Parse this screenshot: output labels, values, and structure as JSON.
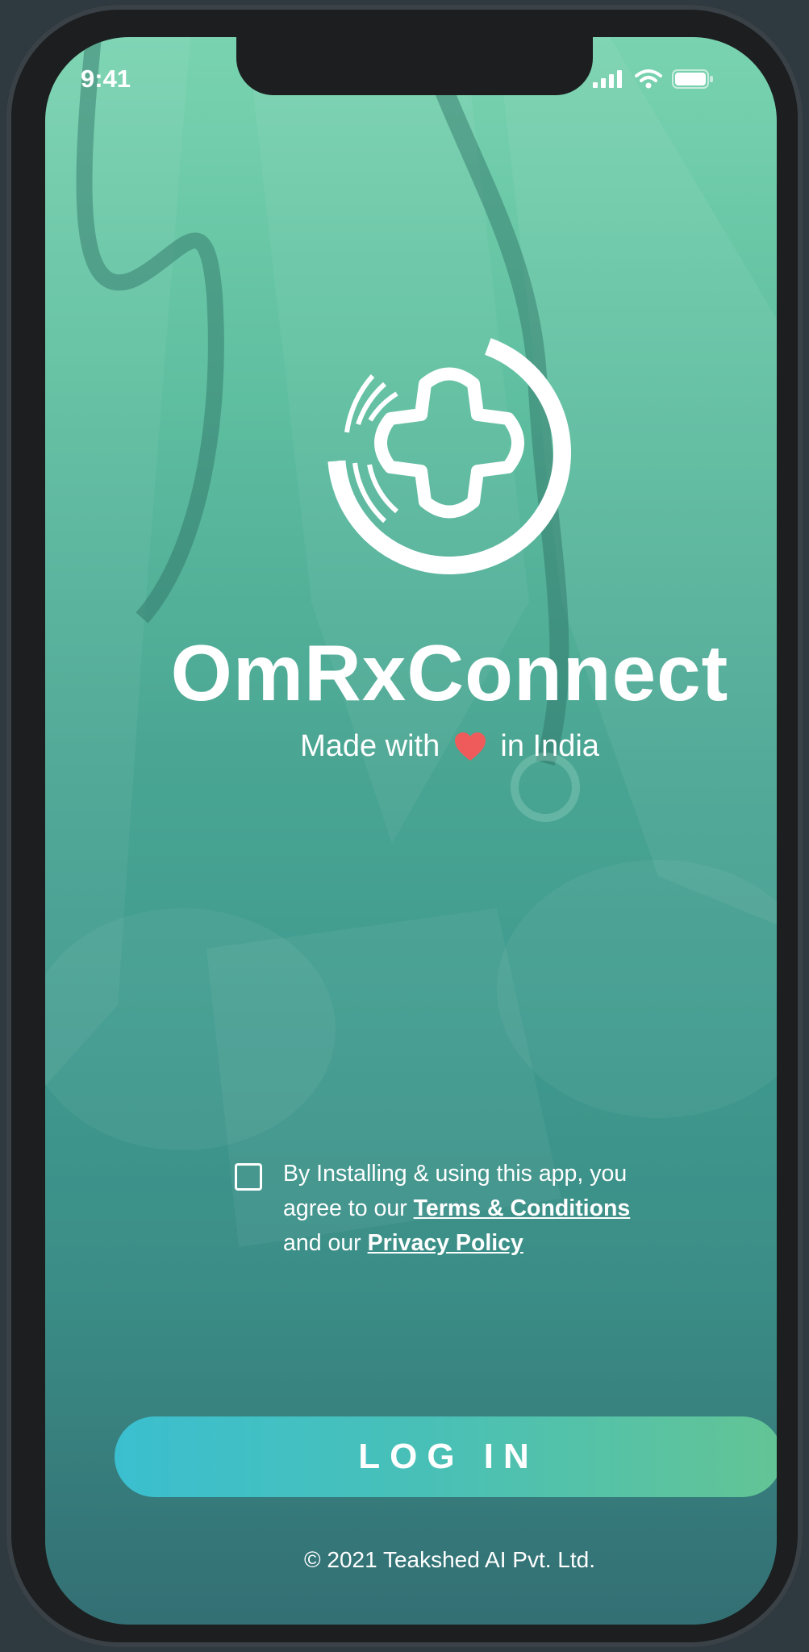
{
  "status_bar": {
    "time": "9:41",
    "icons": [
      "signal-icon",
      "wifi-icon",
      "battery-icon"
    ]
  },
  "brand": {
    "logo_icon": "fingerprint-cross-logo",
    "name": "OmRxConnect",
    "tagline_before": "Made with",
    "tagline_icon": "heart-icon",
    "tagline_after": "in India"
  },
  "consent": {
    "checked": false,
    "line1": "By Installing & using this app, you",
    "line2_prefix": "agree to our",
    "terms_link": "Terms & Conditions",
    "line3_prefix": "and our",
    "privacy_link": "Privacy Policy"
  },
  "login_button": {
    "label": "LOG IN"
  },
  "footer": {
    "copyright": "© 2021 Teakshed AI Pvt. Ltd."
  },
  "colors": {
    "background_top": "#79d3b0",
    "background_bottom": "#336f74",
    "button_start": "#3bbfcf",
    "button_end": "#63c495",
    "heart": "#ef5a5a",
    "text": "#ffffff"
  }
}
